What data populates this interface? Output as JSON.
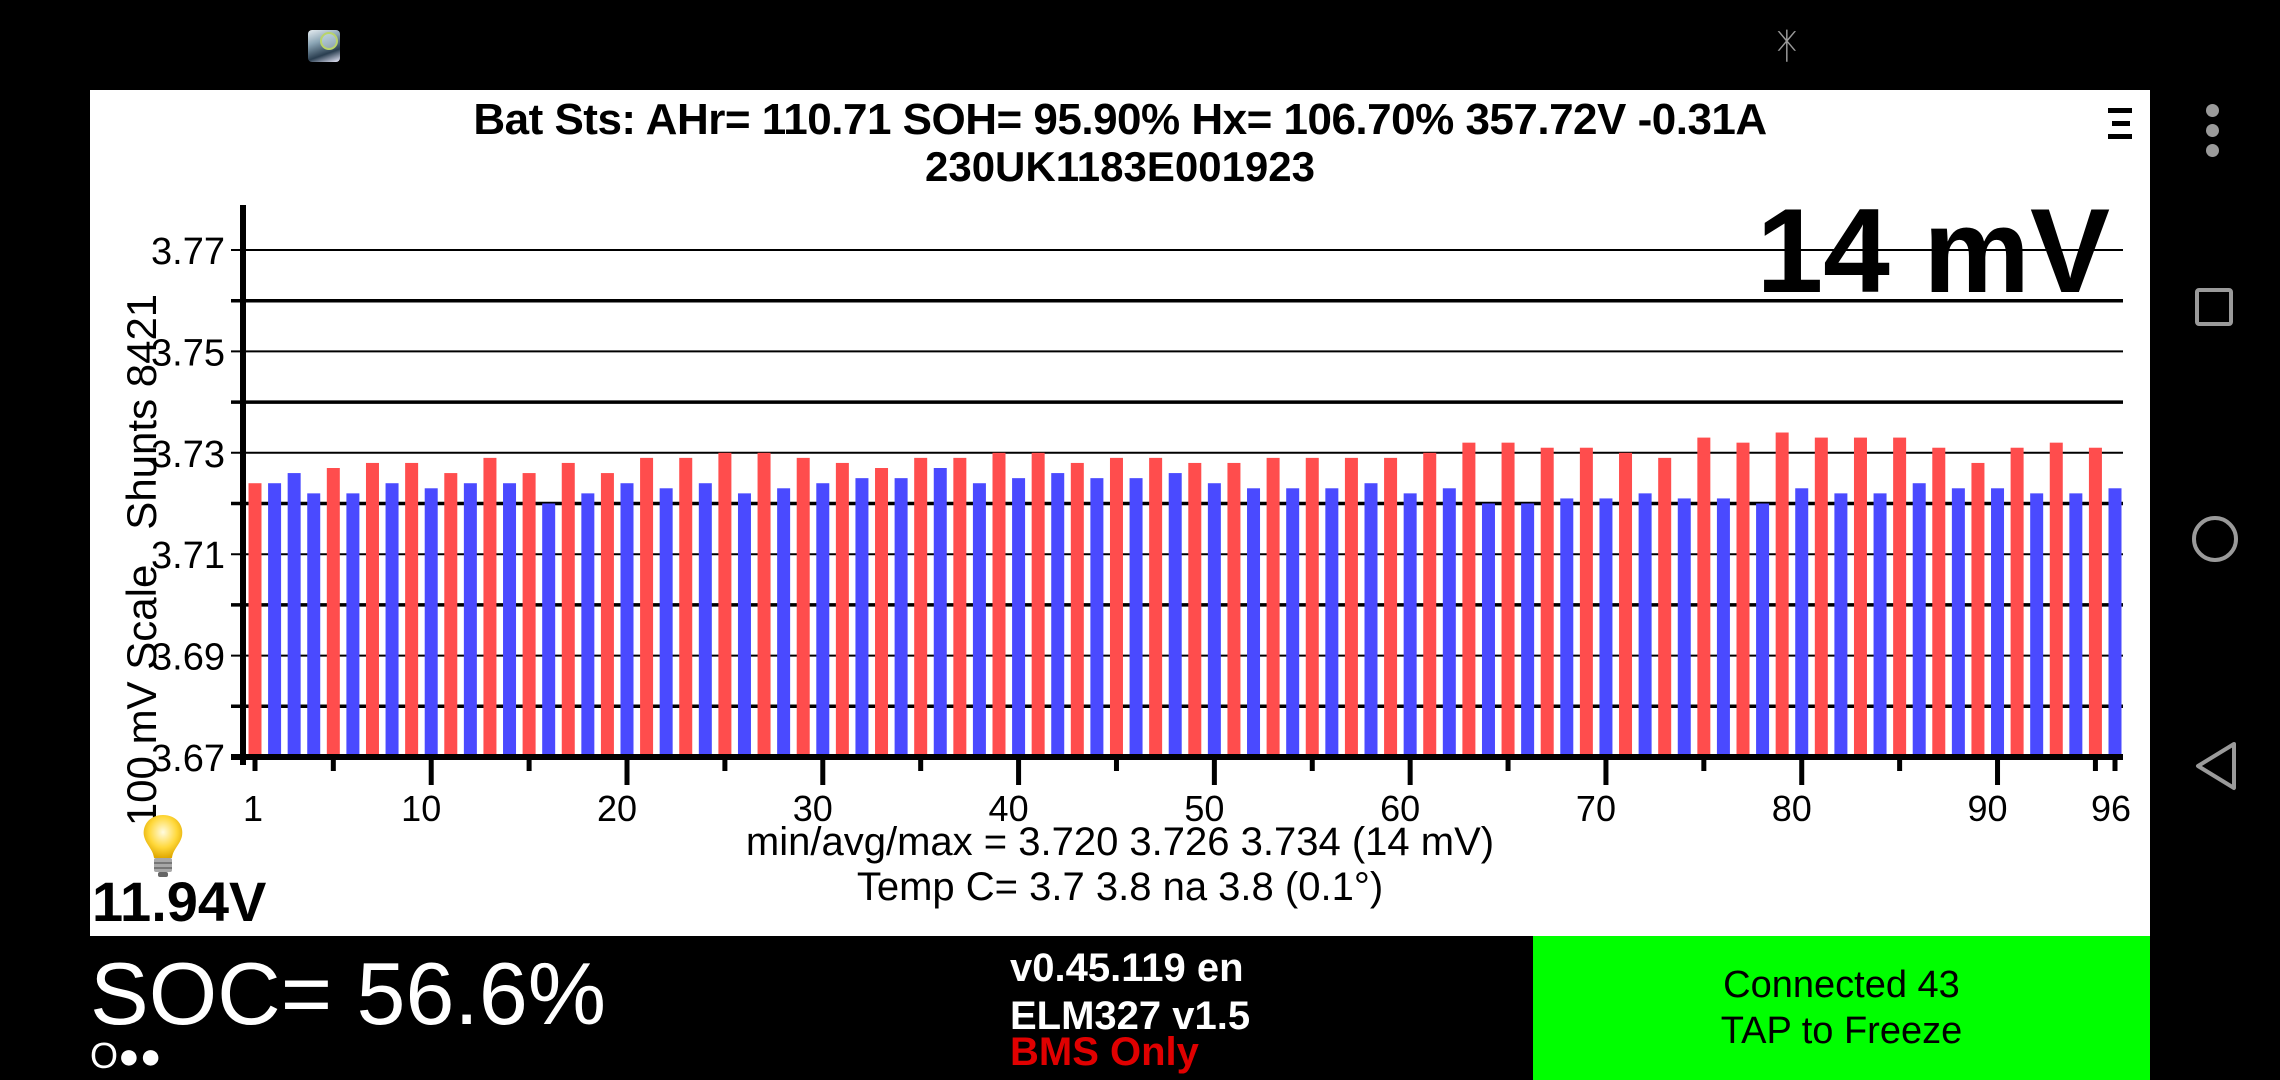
{
  "status_bar": {
    "app_icon": "leafspy-car-magnifier-icon",
    "bluetooth_icon": "bluetooth-icon"
  },
  "header": {
    "line1": "Bat Sts:  AHr= 110.71  SOH= 95.90%   Hx= 106.70%   357.72V -0.31A",
    "line2": "230UK1183E001923",
    "menu_icon": "hamburger-menu-icon"
  },
  "delta_display": "14 mV",
  "stats": {
    "minavgmax": "min/avg/max = 3.720 3.726 3.734  (14 mV)",
    "temp": "Temp C= 3.7  3.8  na  3.8  (0.1°)"
  },
  "aux_battery": {
    "icon": "lightbulb-icon",
    "voltage": "11.94V"
  },
  "bottom": {
    "soc": "SOC= 56.6%",
    "indicator": "O●●",
    "version": "v0.45.119 en",
    "adapter": "ELM327 v1.5",
    "mode": "BMS Only",
    "connect_line1": "Connected 43",
    "connect_line2": "TAP to Freeze"
  },
  "colors": {
    "shunt_bar": "#ff4d4d",
    "normal_bar": "#4a4aff",
    "connected": "#00ff00",
    "mode_text": "#e00000"
  },
  "chart_data": {
    "type": "bar",
    "title": "",
    "ylabel": "100 mV Scale   Shunts 8421",
    "xlabel": "",
    "ylim": [
      3.67,
      3.78
    ],
    "yticks": [
      3.67,
      3.69,
      3.71,
      3.73,
      3.75,
      3.77
    ],
    "ytick_labels": [
      "3.67",
      "3.69",
      "3.71",
      "3.73",
      "3.75",
      "3.77"
    ],
    "y_minor_grid": [
      3.68,
      3.7,
      3.72,
      3.74,
      3.76
    ],
    "xticks": [
      1,
      10,
      20,
      30,
      40,
      50,
      60,
      70,
      80,
      90,
      96
    ],
    "xtick_labels": [
      "1",
      "10",
      "20",
      "30",
      "40",
      "50",
      "60",
      "70",
      "80",
      "90",
      "96"
    ],
    "grid": true,
    "categories": [
      1,
      2,
      3,
      4,
      5,
      6,
      7,
      8,
      9,
      10,
      11,
      12,
      13,
      14,
      15,
      16,
      17,
      18,
      19,
      20,
      21,
      22,
      23,
      24,
      25,
      26,
      27,
      28,
      29,
      30,
      31,
      32,
      33,
      34,
      35,
      36,
      37,
      38,
      39,
      40,
      41,
      42,
      43,
      44,
      45,
      46,
      47,
      48,
      49,
      50,
      51,
      52,
      53,
      54,
      55,
      56,
      57,
      58,
      59,
      60,
      61,
      62,
      63,
      64,
      65,
      66,
      67,
      68,
      69,
      70,
      71,
      72,
      73,
      74,
      75,
      76,
      77,
      78,
      79,
      80,
      81,
      82,
      83,
      84,
      85,
      86,
      87,
      88,
      89,
      90,
      91,
      92,
      93,
      94,
      95,
      96
    ],
    "values": [
      3.724,
      3.724,
      3.726,
      3.722,
      3.727,
      3.722,
      3.728,
      3.724,
      3.728,
      3.723,
      3.726,
      3.724,
      3.729,
      3.724,
      3.726,
      3.72,
      3.728,
      3.722,
      3.726,
      3.724,
      3.729,
      3.723,
      3.729,
      3.724,
      3.73,
      3.722,
      3.73,
      3.723,
      3.729,
      3.724,
      3.728,
      3.725,
      3.727,
      3.725,
      3.729,
      3.727,
      3.729,
      3.724,
      3.73,
      3.725,
      3.73,
      3.726,
      3.728,
      3.725,
      3.729,
      3.725,
      3.729,
      3.726,
      3.728,
      3.724,
      3.728,
      3.723,
      3.729,
      3.723,
      3.729,
      3.723,
      3.729,
      3.724,
      3.729,
      3.722,
      3.73,
      3.723,
      3.732,
      3.72,
      3.732,
      3.72,
      3.731,
      3.721,
      3.731,
      3.721,
      3.73,
      3.722,
      3.729,
      3.721,
      3.733,
      3.721,
      3.732,
      3.72,
      3.734,
      3.723,
      3.733,
      3.722,
      3.733,
      3.722,
      3.733,
      3.724,
      3.731,
      3.723,
      3.728,
      3.723,
      3.731,
      3.722,
      3.732,
      3.722,
      3.731,
      3.723
    ],
    "bar_colors": [
      "red",
      "blue",
      "blue",
      "blue",
      "red",
      "blue",
      "red",
      "blue",
      "red",
      "blue",
      "red",
      "blue",
      "red",
      "blue",
      "red",
      "blue",
      "red",
      "blue",
      "red",
      "blue",
      "red",
      "blue",
      "red",
      "blue",
      "red",
      "blue",
      "red",
      "blue",
      "red",
      "blue",
      "red",
      "blue",
      "red",
      "blue",
      "red",
      "blue",
      "red",
      "blue",
      "red",
      "blue",
      "red",
      "blue",
      "red",
      "blue",
      "red",
      "blue",
      "red",
      "blue",
      "red",
      "blue",
      "red",
      "blue",
      "red",
      "blue",
      "red",
      "blue",
      "red",
      "blue",
      "red",
      "blue",
      "red",
      "blue",
      "red",
      "blue",
      "red",
      "blue",
      "red",
      "blue",
      "red",
      "blue",
      "red",
      "blue",
      "red",
      "blue",
      "red",
      "blue",
      "red",
      "blue",
      "red",
      "blue",
      "red",
      "blue",
      "red",
      "blue",
      "red",
      "blue",
      "red",
      "blue",
      "red",
      "blue",
      "red",
      "blue",
      "red",
      "blue",
      "red",
      "blue"
    ],
    "annotation": "14 mV"
  }
}
